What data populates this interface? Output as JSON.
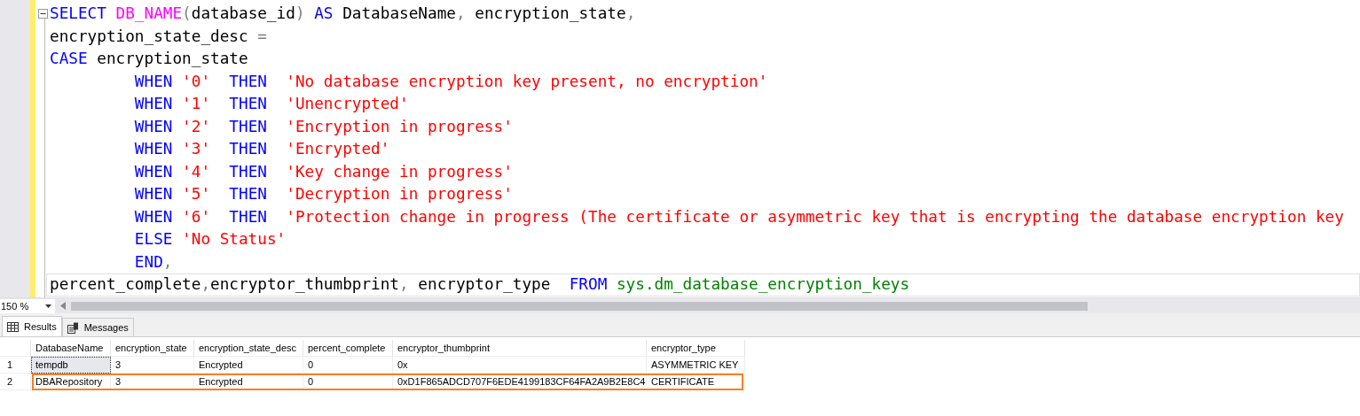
{
  "editor": {
    "lines": [
      {
        "indented": false,
        "current": false,
        "tokens": [
          {
            "t": "SELECT ",
            "kind": "kw"
          },
          {
            "t": "DB_NAME",
            "kind": "fn"
          },
          {
            "t": "(",
            "kind": "op"
          },
          {
            "t": "database_id",
            "kind": "plain"
          },
          {
            "t": ") ",
            "kind": "op"
          },
          {
            "t": "AS",
            "kind": "kw"
          },
          {
            "t": " DatabaseName",
            "kind": "plain"
          },
          {
            "t": ",",
            "kind": "op"
          },
          {
            "t": " encryption_state",
            "kind": "plain"
          },
          {
            "t": ",",
            "kind": "op"
          }
        ]
      },
      {
        "indented": false,
        "current": false,
        "tokens": [
          {
            "t": "encryption_state_desc ",
            "kind": "plain"
          },
          {
            "t": "=",
            "kind": "op"
          }
        ]
      },
      {
        "indented": false,
        "current": false,
        "tokens": [
          {
            "t": "CASE",
            "kind": "kw"
          },
          {
            "t": " encryption_state",
            "kind": "plain"
          }
        ]
      },
      {
        "indented": true,
        "current": false,
        "tokens": [
          {
            "t": "WHEN ",
            "kind": "kw"
          },
          {
            "t": "'0'  ",
            "kind": "str"
          },
          {
            "t": "THEN  ",
            "kind": "kw"
          },
          {
            "t": "'No database encryption key present, no encryption'",
            "kind": "str"
          }
        ]
      },
      {
        "indented": true,
        "current": false,
        "tokens": [
          {
            "t": "WHEN ",
            "kind": "kw"
          },
          {
            "t": "'1'  ",
            "kind": "str"
          },
          {
            "t": "THEN  ",
            "kind": "kw"
          },
          {
            "t": "'Unencrypted'",
            "kind": "str"
          }
        ]
      },
      {
        "indented": true,
        "current": false,
        "tokens": [
          {
            "t": "WHEN ",
            "kind": "kw"
          },
          {
            "t": "'2'  ",
            "kind": "str"
          },
          {
            "t": "THEN  ",
            "kind": "kw"
          },
          {
            "t": "'Encryption in progress'",
            "kind": "str"
          }
        ]
      },
      {
        "indented": true,
        "current": false,
        "tokens": [
          {
            "t": "WHEN ",
            "kind": "kw"
          },
          {
            "t": "'3'  ",
            "kind": "str"
          },
          {
            "t": "THEN  ",
            "kind": "kw"
          },
          {
            "t": "'Encrypted'",
            "kind": "str"
          }
        ]
      },
      {
        "indented": true,
        "current": false,
        "tokens": [
          {
            "t": "WHEN ",
            "kind": "kw"
          },
          {
            "t": "'4'  ",
            "kind": "str"
          },
          {
            "t": "THEN  ",
            "kind": "kw"
          },
          {
            "t": "'Key change in progress'",
            "kind": "str"
          }
        ]
      },
      {
        "indented": true,
        "current": false,
        "tokens": [
          {
            "t": "WHEN ",
            "kind": "kw"
          },
          {
            "t": "'5'  ",
            "kind": "str"
          },
          {
            "t": "THEN  ",
            "kind": "kw"
          },
          {
            "t": "'Decryption in progress'",
            "kind": "str"
          }
        ]
      },
      {
        "indented": true,
        "current": false,
        "tokens": [
          {
            "t": "WHEN ",
            "kind": "kw"
          },
          {
            "t": "'6'  ",
            "kind": "str"
          },
          {
            "t": "THEN  ",
            "kind": "kw"
          },
          {
            "t": "'Protection change in progress (The certificate or asymmetric key that is encrypting the database encryption key",
            "kind": "str"
          }
        ]
      },
      {
        "indented": true,
        "current": false,
        "tokens": [
          {
            "t": "ELSE ",
            "kind": "kw"
          },
          {
            "t": "'No Status'",
            "kind": "str"
          }
        ]
      },
      {
        "indented": true,
        "current": false,
        "tokens": [
          {
            "t": "END",
            "kind": "kw"
          },
          {
            "t": ",",
            "kind": "op"
          }
        ]
      },
      {
        "indented": false,
        "current": true,
        "tokens": [
          {
            "t": "percent_complete",
            "kind": "plain"
          },
          {
            "t": ",",
            "kind": "op"
          },
          {
            "t": "encryptor_thumbprint",
            "kind": "plain"
          },
          {
            "t": ",",
            "kind": "op"
          },
          {
            "t": " encryptor_type  ",
            "kind": "plain"
          },
          {
            "t": "FROM ",
            "kind": "kw"
          },
          {
            "t": "sys.dm_database_encryption_keys",
            "kind": "sys"
          }
        ]
      }
    ]
  },
  "zoom": {
    "value": "150 %"
  },
  "tabs": [
    {
      "label": "Results",
      "selected": true,
      "kind": "grid"
    },
    {
      "label": "Messages",
      "selected": false,
      "kind": "messages"
    }
  ],
  "table": {
    "columns": [
      "DatabaseName",
      "encryption_state",
      "encryption_state_desc",
      "percent_complete",
      "encryptor_thumbprint",
      "encryptor_type"
    ],
    "rows": [
      {
        "number": "1",
        "selected": true,
        "highlighted": false,
        "cells": [
          "tempdb",
          "3",
          "Encrypted",
          "0",
          "0x",
          "ASYMMETRIC KEY"
        ]
      },
      {
        "number": "2",
        "selected": false,
        "highlighted": true,
        "cells": [
          "DBARepository",
          "3",
          "Encrypted",
          "0",
          "0xD1F865ADCD707F6EDE4199183CF64FA2A9B2E8C4",
          "CERTIFICATE"
        ]
      }
    ]
  }
}
